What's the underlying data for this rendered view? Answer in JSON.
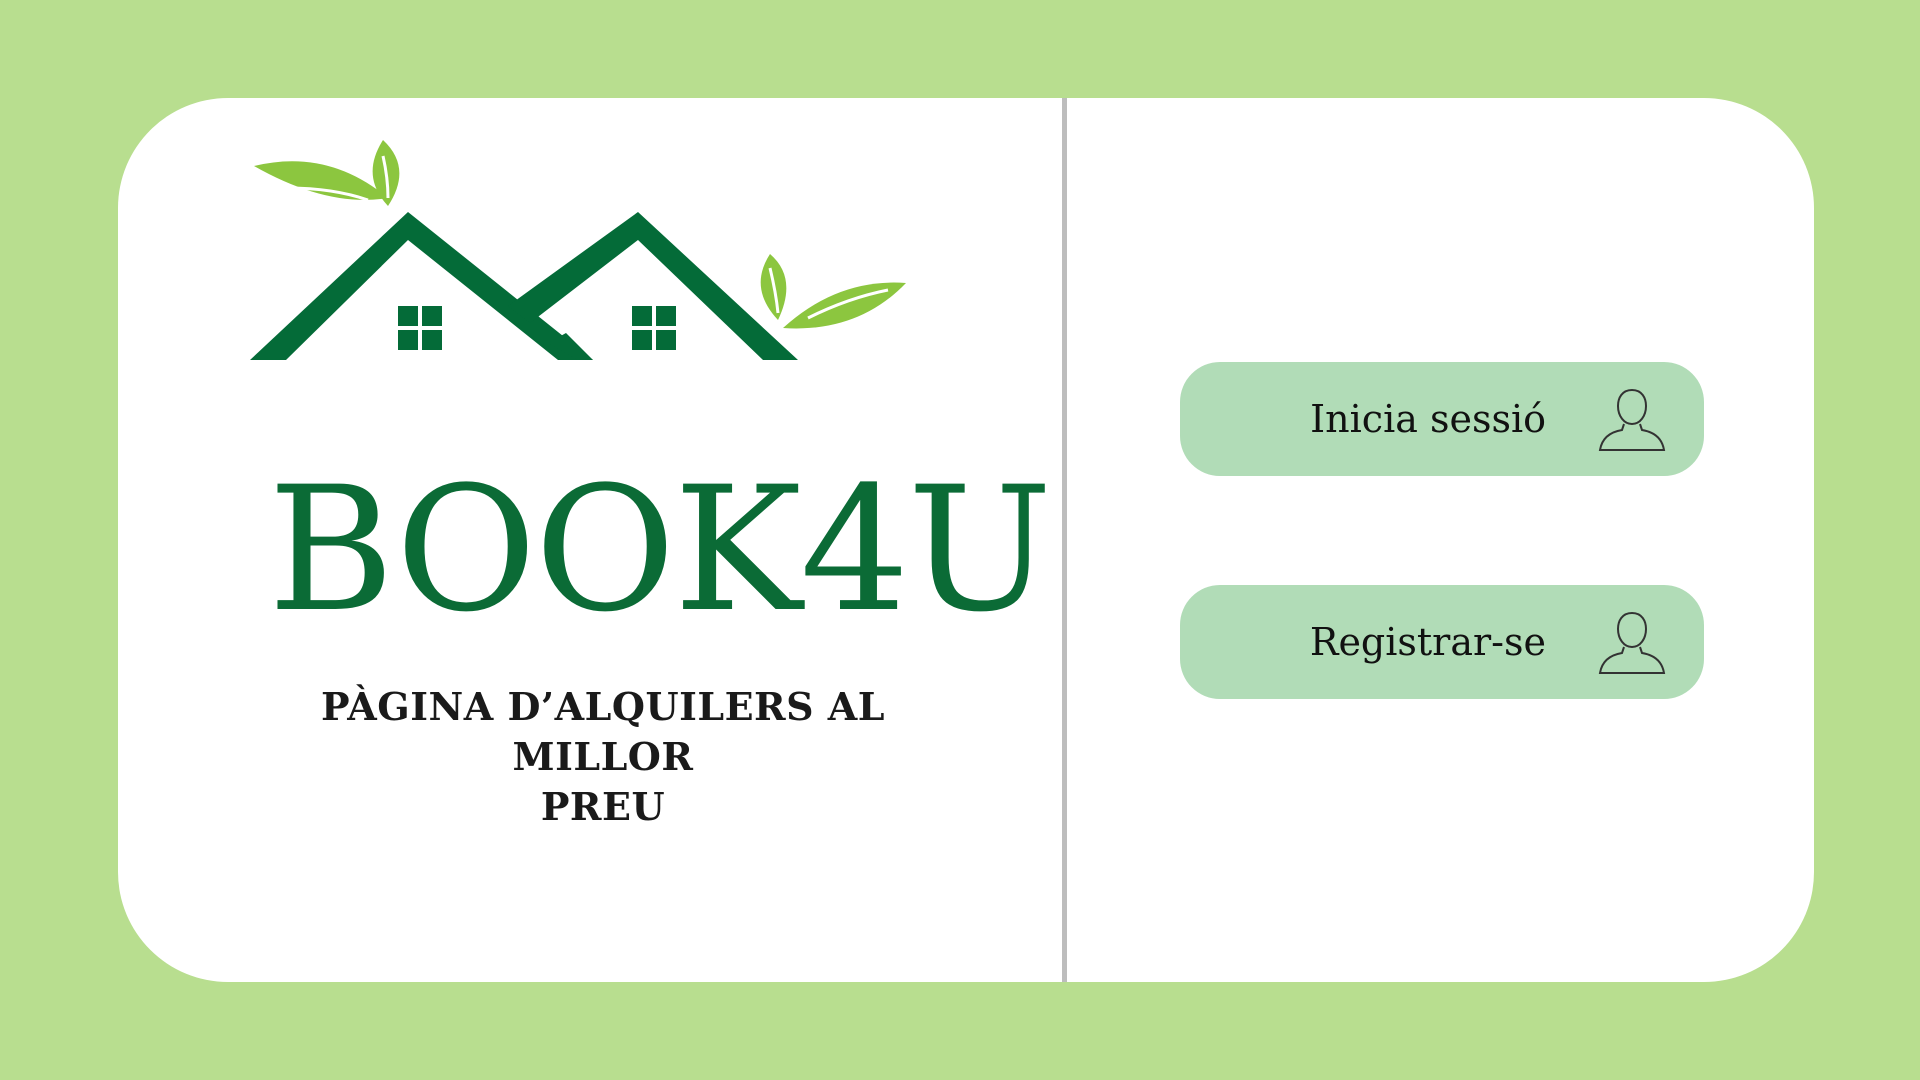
{
  "brand": {
    "name": "BOOK4U",
    "tagline_line1": "PÀGINA D’ALQUILERS AL MILLOR",
    "tagline_line2": "PREU"
  },
  "actions": {
    "login_label": "Inicia sessió",
    "register_label": "Registrar-se"
  },
  "icons": {
    "logo": "houses-with-leaves-logo",
    "login": "user-icon",
    "register": "user-icon"
  },
  "colors": {
    "background": "#b8de8f",
    "card": "#ffffff",
    "brand_green": "#0b6b36",
    "leaf_green": "#8cc63f",
    "button": "#b1dcb7",
    "divider": "#bdbdbd"
  }
}
